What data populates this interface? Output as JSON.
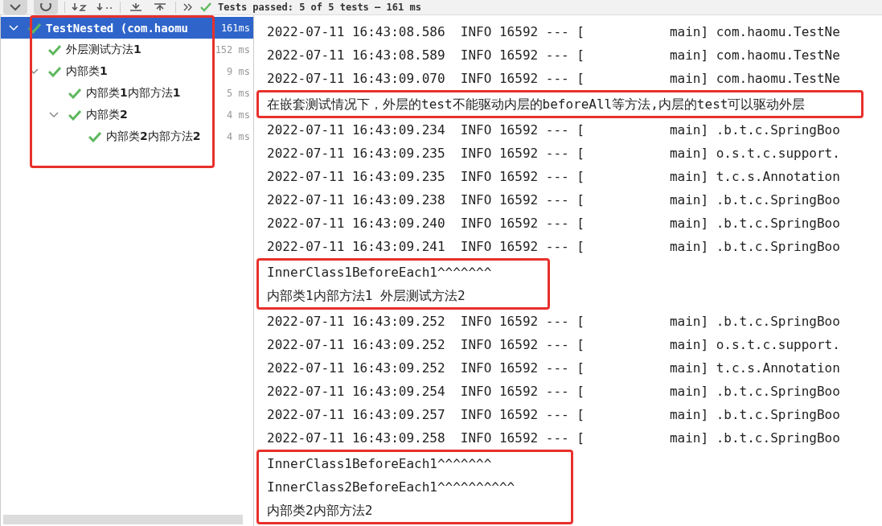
{
  "toolbar": {
    "status": "Tests passed: 5 of 5 tests – 161 ms"
  },
  "test_tree": {
    "highlighted": true,
    "items": [
      {
        "label": "TestNested (com.haomu",
        "duration": "161ms",
        "selected": true,
        "expanded": true,
        "children": [
          {
            "label": "外层测试方法**1**",
            "duration": "152 ms",
            "selected": false
          },
          {
            "label": "内部类**1**",
            "duration": "9 ms",
            "selected": false,
            "expanded": true,
            "children": [
              {
                "label": "内部类**1**内部方法**1**",
                "duration": "5 ms",
                "selected": false
              },
              {
                "label": "内部类**2**",
                "duration": "4 ms",
                "selected": false,
                "expanded": true,
                "children": [
                  {
                    "label": "内部类**2**内部方法**2**",
                    "duration": "4 ms",
                    "selected": false
                  }
                ]
              }
            ]
          }
        ]
      }
    ]
  },
  "console": {
    "groups": [
      {
        "highlighted": false,
        "lines": [
          {
            "text": "2022-07-11 16:43:08.586  INFO 16592 --- [           main] com.haomu.TestNe"
          },
          {
            "text": "2022-07-11 16:43:08.589  INFO 16592 --- [           main] com.haomu.TestNe"
          },
          {
            "text": "2022-07-11 16:43:09.070  INFO 16592 --- [           main] com.haomu.TestNe"
          }
        ]
      },
      {
        "highlighted": true,
        "lines": [
          {
            "text": "在嵌套测试情况下，外层的test不能驱动内层的beforeAll等方法,内层的test可以驱动外层"
          }
        ]
      },
      {
        "highlighted": false,
        "lines": [
          {
            "text": "2022-07-11 16:43:09.234  INFO 16592 --- [           main] .b.t.c.SpringBoo"
          },
          {
            "text": "2022-07-11 16:43:09.235  INFO 16592 --- [           main] o.s.t.c.support."
          },
          {
            "text": "2022-07-11 16:43:09.235  INFO 16592 --- [           main] t.c.s.Annotation"
          },
          {
            "text": "2022-07-11 16:43:09.238  INFO 16592 --- [           main] .b.t.c.SpringBoo"
          },
          {
            "text": "2022-07-11 16:43:09.240  INFO 16592 --- [           main] .b.t.c.SpringBoo"
          },
          {
            "text": "2022-07-11 16:43:09.241  INFO 16592 --- [           main] .b.t.c.SpringBoo"
          }
        ]
      },
      {
        "highlighted": true,
        "lines": [
          {
            "text": "InnerClass1BeforeEach1^^^^^^^"
          },
          {
            "text": "内部类1内部方法1 外层测试方法2"
          }
        ]
      },
      {
        "highlighted": false,
        "lines": [
          {
            "text": "2022-07-11 16:43:09.252  INFO 16592 --- [           main] .b.t.c.SpringBoo"
          },
          {
            "text": "2022-07-11 16:43:09.252  INFO 16592 --- [           main] o.s.t.c.support."
          },
          {
            "text": "2022-07-11 16:43:09.252  INFO 16592 --- [           main] t.c.s.Annotation"
          },
          {
            "text": "2022-07-11 16:43:09.254  INFO 16592 --- [           main] .b.t.c.SpringBoo"
          },
          {
            "text": "2022-07-11 16:43:09.257  INFO 16592 --- [           main] .b.t.c.SpringBoo"
          },
          {
            "text": "2022-07-11 16:43:09.258  INFO 16592 --- [           main] .b.t.c.SpringBoo"
          }
        ]
      },
      {
        "highlighted": true,
        "lines": [
          {
            "text": "InnerClass1BeforeEach1^^^^^^^"
          },
          {
            "text": "InnerClass2BeforeEach1^^^^^^^^^^"
          },
          {
            "text": "内部类2内部方法2"
          }
        ]
      }
    ]
  }
}
